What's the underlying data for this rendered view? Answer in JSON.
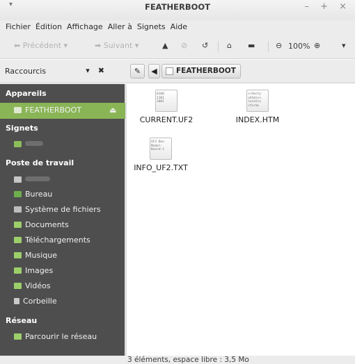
{
  "window": {
    "title": "FEATHERBOOT",
    "menu_glyph": "▾",
    "controls": "– + ×"
  },
  "menubar": [
    "Fichier",
    "Édition",
    "Affichage",
    "Aller à",
    "Signets",
    "Aide"
  ],
  "toolbar": {
    "back_label": "Précédent",
    "forward_label": "Suivant",
    "zoom_level": "100%"
  },
  "sidebar": {
    "header_label": "Raccourcis",
    "sections": {
      "devices": "Appareils",
      "bookmarks": "Signets",
      "computer": "Poste de travail",
      "network": "Réseau"
    },
    "device_item": "FEATHERBOOT",
    "places": [
      {
        "label": "Bureau",
        "color": "#6fae4c"
      },
      {
        "label": "Système de fichiers",
        "color": "#bdbdbd"
      },
      {
        "label": "Documents",
        "color": "#9ccf6a"
      },
      {
        "label": "Téléchargements",
        "color": "#9ccf6a"
      },
      {
        "label": "Musique",
        "color": "#9ccf6a"
      },
      {
        "label": "Images",
        "color": "#9ccf6a"
      },
      {
        "label": "Vidéos",
        "color": "#9ccf6a"
      },
      {
        "label": "Corbeille",
        "color": "#c9c9c9"
      }
    ],
    "network_item": "Parcourir le réseau"
  },
  "pathbar": {
    "crumb": "FEATHERBOOT"
  },
  "files": [
    {
      "name": "CURRENT.UF2",
      "preview": "0100\n1101\n1001"
    },
    {
      "name": "INDEX.HTM",
      "preview": "<!docty\n<html><\nlocatio\n<form>"
    },
    {
      "name": "INFO_UF2.TXT",
      "preview": "UF2 Boo\nModel:\nBoard-I"
    }
  ],
  "status": {
    "text": "3 éléments, espace libre : 3,5 Mo"
  },
  "colors": {
    "sidebar_bg": "#4e4e4e",
    "selection": "#8ab556"
  }
}
